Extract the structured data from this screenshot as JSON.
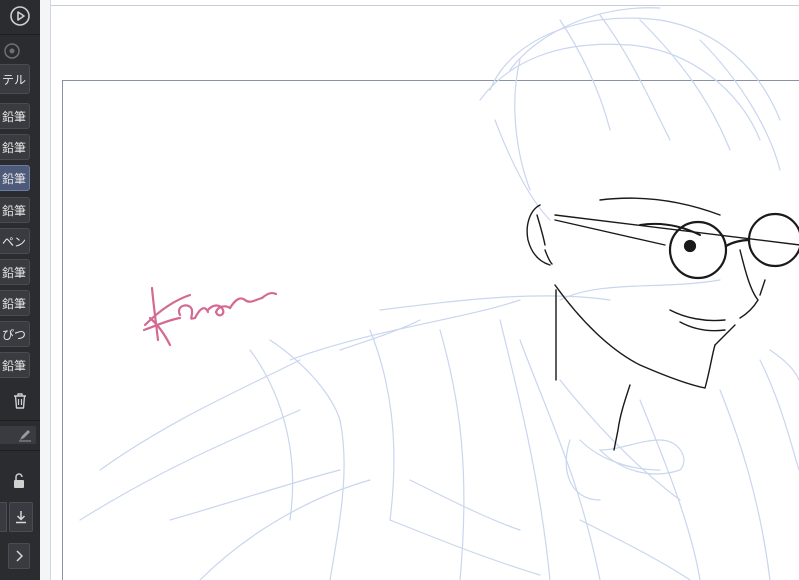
{
  "sidebar": {
    "header_label": "テル",
    "items": [
      {
        "label": "鉛筆",
        "selected": false
      },
      {
        "label": "鉛筆",
        "selected": false
      },
      {
        "label": "鉛筆",
        "selected": true
      },
      {
        "label": "鉛筆",
        "selected": false
      },
      {
        "label": "ペン",
        "selected": false
      },
      {
        "label": "鉛筆",
        "selected": false
      },
      {
        "label": "鉛筆",
        "selected": false
      },
      {
        "label": "ぴつ",
        "selected": false
      },
      {
        "label": "鉛筆",
        "selected": false
      }
    ],
    "icons": {
      "play": "play-circle-icon",
      "dial": "dial-icon",
      "trash": "trash-icon",
      "pen": "pen-icon",
      "lock": "unlock-icon",
      "download": "download-icon",
      "arrow": "chevron-right-icon"
    }
  },
  "canvas": {
    "signature": "Karen",
    "colors": {
      "sketch": "#c9d6ee",
      "line": "#1a1a1a",
      "signature": "#d46a92",
      "frame": "#8a93a6"
    }
  }
}
